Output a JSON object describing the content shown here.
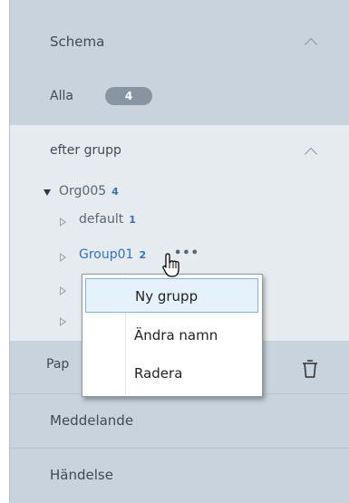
{
  "sidebar": {
    "schema": {
      "title": "Schema"
    },
    "alla": {
      "label": "Alla",
      "count": "4"
    },
    "efter_grupp": {
      "title": "efter grupp"
    },
    "tree": {
      "root": {
        "label": "Org005",
        "count": "4"
      },
      "children": [
        {
          "label": "default",
          "count": "1"
        },
        {
          "label": "Group01",
          "count": "2"
        }
      ]
    },
    "partial_item": {
      "label": "Pap"
    },
    "meddelande": {
      "title": "Meddelande"
    },
    "handelse": {
      "title": "Händelse"
    }
  },
  "context_menu": {
    "items": [
      {
        "label": "Ny grupp",
        "highlighted": true
      },
      {
        "label": "Ändra namn"
      },
      {
        "label": "Radera"
      }
    ]
  },
  "icons": {
    "trash": "trash-icon",
    "more": "more-dots-icon",
    "cursor": "hand-pointer-icon"
  },
  "colors": {
    "accent": "#2f74c0",
    "panel": "#c9d3dd",
    "panel_light": "#e6ebf0",
    "menu_highlight": "#e5f1fb"
  }
}
